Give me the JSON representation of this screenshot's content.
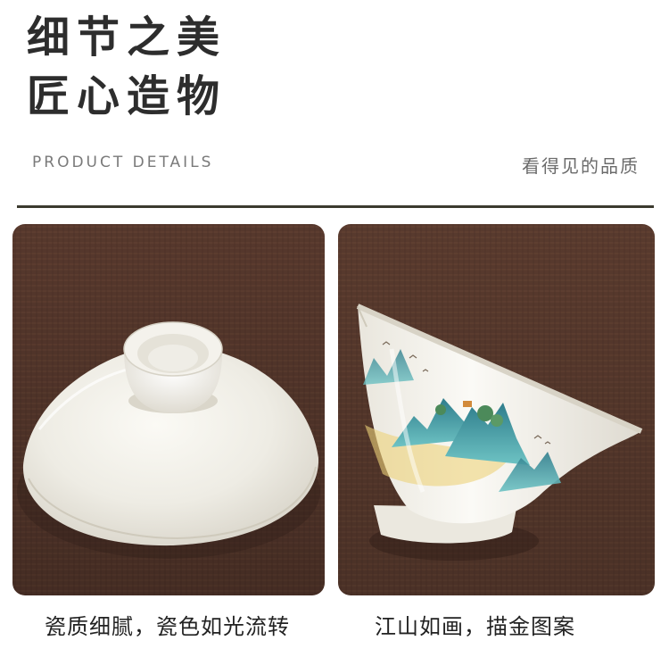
{
  "header": {
    "title_line1": "细节之美",
    "title_line2": "匠心造物",
    "subtitle_en": "PRODUCT DETAILS",
    "subtitle_cn": "看得见的品质"
  },
  "photos": [
    {
      "subject": "white-porcelain-gaiwan-lid",
      "caption": "瓷质细腻，瓷色如光流转"
    },
    {
      "subject": "painted-landscape-porcelain-cup",
      "caption": "江山如画，描金图案"
    }
  ],
  "colors": {
    "divider": "#3b3a2e",
    "background_table": "#5a3a2e",
    "porcelain": "#f1efe8",
    "landscape_teal": "#3f9ea6",
    "landscape_gold": "#e6c35a"
  }
}
